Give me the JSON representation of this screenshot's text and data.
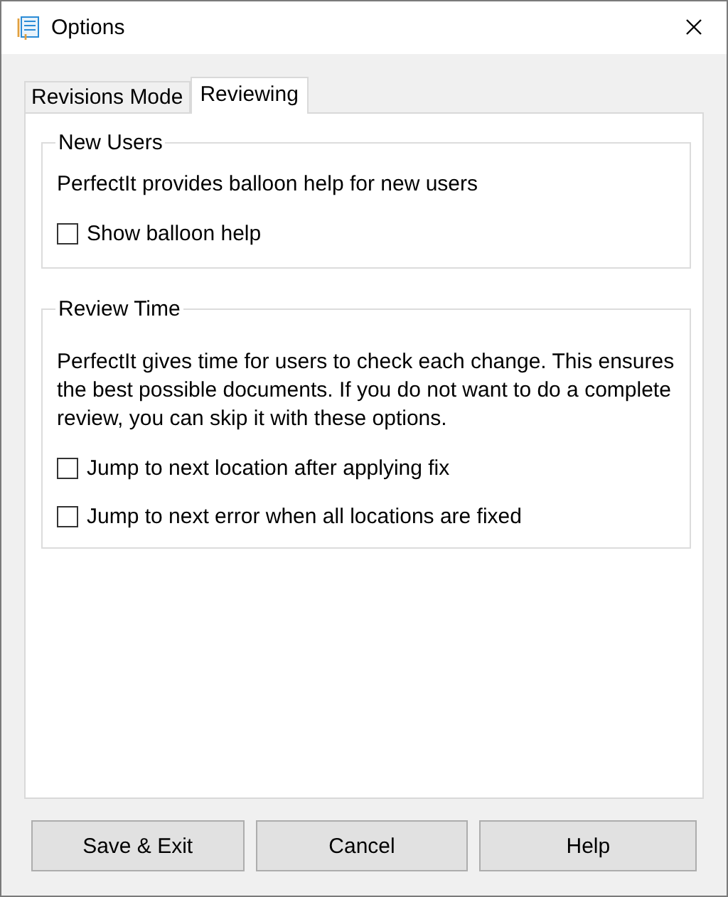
{
  "window": {
    "title": "Options"
  },
  "tabs": [
    {
      "label": "Revisions Mode",
      "selected": false
    },
    {
      "label": "Reviewing",
      "selected": true
    }
  ],
  "groups": [
    {
      "title": "New Users",
      "description": "PerfectIt provides balloon help for new users",
      "options": [
        {
          "label": "Show balloon help",
          "checked": false
        }
      ]
    },
    {
      "title": "Review Time",
      "description": "PerfectIt gives time for users to check each change. This ensures the best possible documents. If you do not want to do a complete review, you can skip it with these options.",
      "options": [
        {
          "label": "Jump to next location after applying fix",
          "checked": false
        },
        {
          "label": "Jump to next error when all locations are fixed",
          "checked": false
        }
      ]
    }
  ],
  "buttons": [
    "Save & Exit",
    "Cancel",
    "Help"
  ]
}
